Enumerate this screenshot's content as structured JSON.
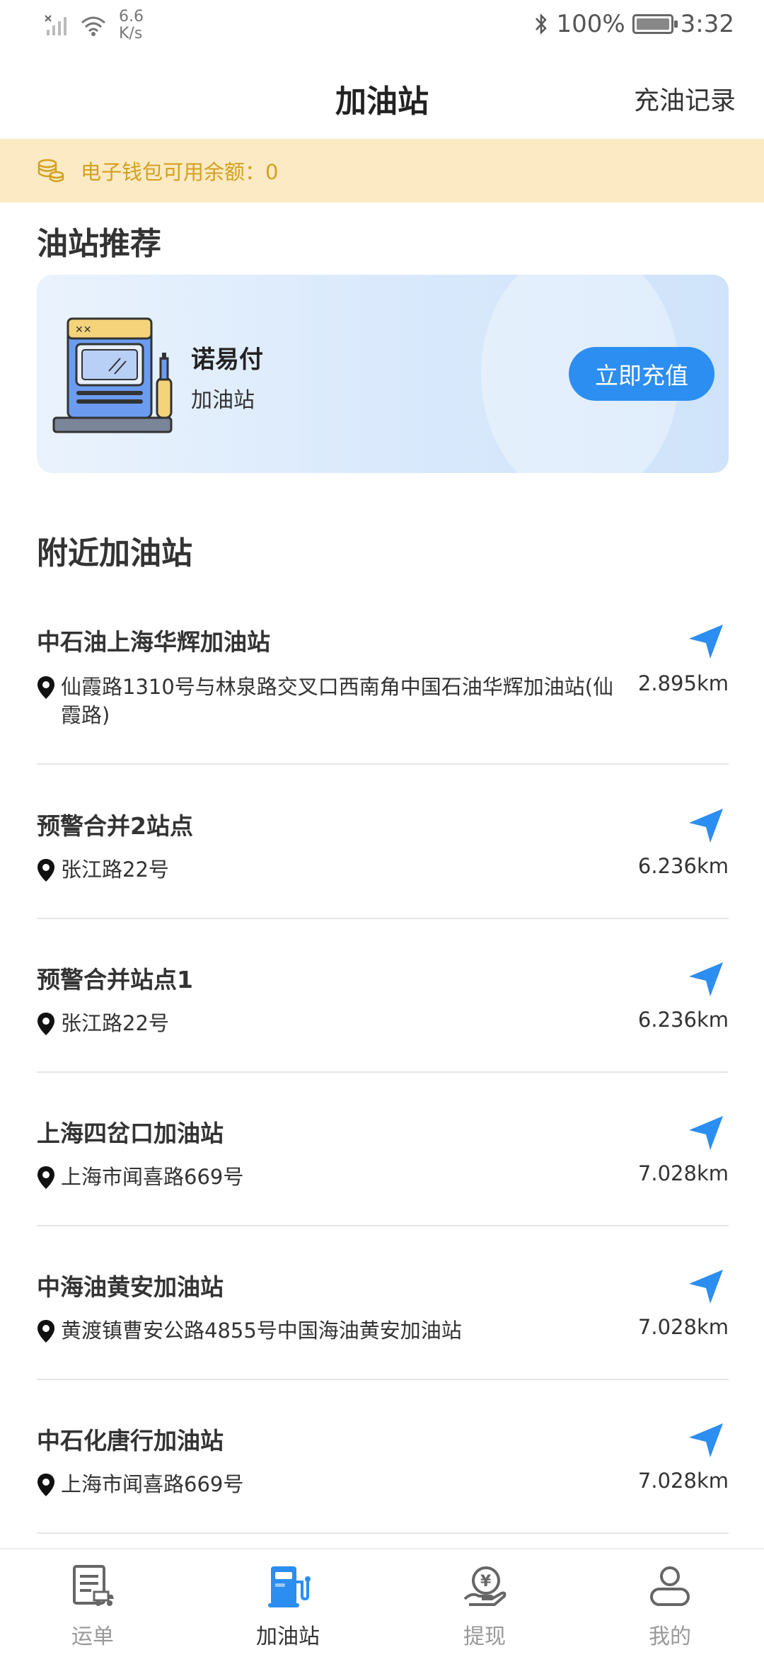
{
  "status_bar": {
    "net_speed": "6.6",
    "net_speed_unit": "K/s",
    "battery": "100%",
    "time": "3:32"
  },
  "header": {
    "title": "加油站",
    "action": "充油记录"
  },
  "wallet": {
    "label": "电子钱包可用余额：0"
  },
  "recommend": {
    "section_title": "油站推荐",
    "name": "诺易付",
    "sub": "加油站",
    "button": "立即充值"
  },
  "nearby": {
    "section_title": "附近加油站",
    "stations": [
      {
        "name": "中石油上海华辉加油站",
        "address": "仙霞路1310号与林泉路交叉口西南角中国石油华辉加油站(仙霞路)",
        "distance": "2.895km"
      },
      {
        "name": "预警合并2站点",
        "address": "张江路22号",
        "distance": "6.236km"
      },
      {
        "name": "预警合并站点1",
        "address": "张江路22号",
        "distance": "6.236km"
      },
      {
        "name": "上海四岔口加油站",
        "address": "上海市闻喜路669号",
        "distance": "7.028km"
      },
      {
        "name": "中海油黄安加油站",
        "address": "黄渡镇曹安公路4855号中国海油黄安加油站",
        "distance": "7.028km"
      },
      {
        "name": "中石化唐行加油站",
        "address": "上海市闻喜路669号",
        "distance": "7.028km"
      }
    ]
  },
  "tabs": [
    {
      "label": "运单",
      "icon": "waybill-icon"
    },
    {
      "label": "加油站",
      "icon": "gas-station-icon",
      "active": true
    },
    {
      "label": "提现",
      "icon": "withdraw-icon"
    },
    {
      "label": "我的",
      "icon": "profile-icon"
    }
  ],
  "colors": {
    "accent": "#2b8ef0",
    "wallet_bg": "#fbeac3",
    "wallet_text": "#d4a01f"
  }
}
